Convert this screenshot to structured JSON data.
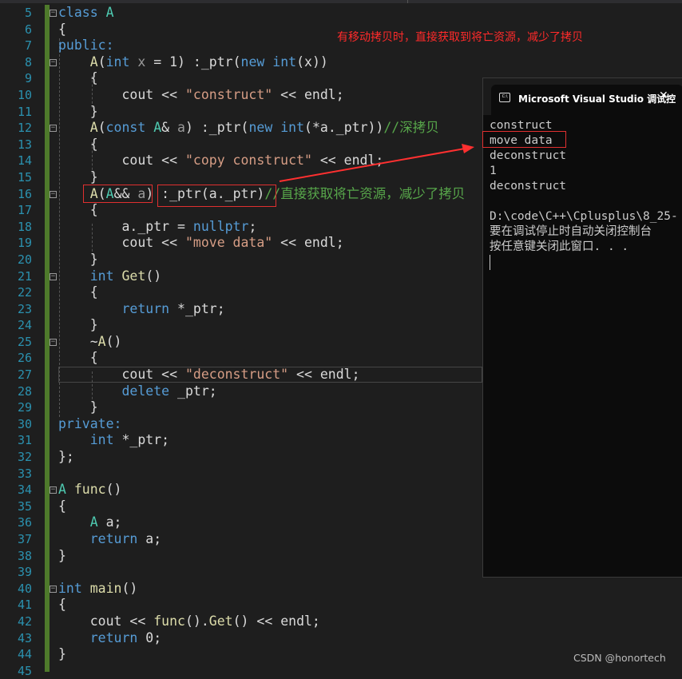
{
  "editor": {
    "line_numbers": [
      "5",
      "6",
      "7",
      "8",
      "9",
      "10",
      "11",
      "12",
      "13",
      "14",
      "15",
      "16",
      "17",
      "18",
      "19",
      "20",
      "21",
      "22",
      "23",
      "24",
      "25",
      "26",
      "27",
      "28",
      "29",
      "30",
      "31",
      "32",
      "33",
      "34",
      "35",
      "36",
      "37",
      "38",
      "39",
      "40",
      "41",
      "42",
      "43",
      "44",
      "45"
    ],
    "current_line": "27",
    "lines": [
      [
        [
          "class",
          "kw"
        ],
        [
          " ",
          ""
        ],
        [
          "A",
          "ty"
        ]
      ],
      [
        [
          "{",
          ""
        ]
      ],
      [
        [
          "public:",
          "kw"
        ]
      ],
      [
        [
          "    ",
          ""
        ],
        [
          "A",
          "fn"
        ],
        [
          "(",
          ""
        ],
        [
          "int",
          "kw"
        ],
        [
          " ",
          ""
        ],
        [
          "x",
          "pm"
        ],
        [
          " = 1) :_ptr(",
          ""
        ],
        [
          "new",
          "kw"
        ],
        [
          " ",
          ""
        ],
        [
          "int",
          "kw"
        ],
        [
          "(x))",
          ""
        ]
      ],
      [
        [
          "    {",
          ""
        ]
      ],
      [
        [
          "        cout << ",
          ""
        ],
        [
          "\"construct\"",
          "str"
        ],
        [
          " << endl;",
          ""
        ]
      ],
      [
        [
          "    }",
          ""
        ]
      ],
      [
        [
          "    ",
          ""
        ],
        [
          "A",
          "fn"
        ],
        [
          "(",
          ""
        ],
        [
          "const",
          "kw"
        ],
        [
          " ",
          ""
        ],
        [
          "A",
          "ty"
        ],
        [
          "& ",
          ""
        ],
        [
          "a",
          "pm"
        ],
        [
          ") :_ptr(",
          ""
        ],
        [
          "new",
          "kw"
        ],
        [
          " ",
          ""
        ],
        [
          "int",
          "kw"
        ],
        [
          "(*a._ptr))",
          ""
        ],
        [
          "//深拷贝",
          "cm"
        ]
      ],
      [
        [
          "    {",
          ""
        ]
      ],
      [
        [
          "        cout << ",
          ""
        ],
        [
          "\"copy construct\"",
          "str"
        ],
        [
          " << endl;",
          ""
        ]
      ],
      [
        [
          "    }",
          ""
        ]
      ],
      [
        [
          "    ",
          ""
        ],
        [
          "A",
          "fn"
        ],
        [
          "(",
          ""
        ],
        [
          "A",
          "ty"
        ],
        [
          "&& ",
          ""
        ],
        [
          "a",
          "pm"
        ],
        [
          ") :_ptr(a._ptr)",
          ""
        ],
        [
          "//直接获取将亡资源，减少了拷贝",
          "cm"
        ]
      ],
      [
        [
          "    {",
          ""
        ]
      ],
      [
        [
          "        a._ptr = ",
          ""
        ],
        [
          "nullptr",
          "kw"
        ],
        [
          ";",
          ""
        ]
      ],
      [
        [
          "        cout << ",
          ""
        ],
        [
          "\"move data\"",
          "str"
        ],
        [
          " << endl;",
          ""
        ]
      ],
      [
        [
          "    }",
          ""
        ]
      ],
      [
        [
          "    ",
          ""
        ],
        [
          "int",
          "kw"
        ],
        [
          " ",
          ""
        ],
        [
          "Get",
          "fn"
        ],
        [
          "()",
          ""
        ]
      ],
      [
        [
          "    {",
          ""
        ]
      ],
      [
        [
          "        ",
          ""
        ],
        [
          "return",
          "kw"
        ],
        [
          " *_ptr;",
          ""
        ]
      ],
      [
        [
          "    }",
          ""
        ]
      ],
      [
        [
          "    ~",
          ""
        ],
        [
          "A",
          "fn"
        ],
        [
          "()",
          ""
        ]
      ],
      [
        [
          "    {",
          ""
        ]
      ],
      [
        [
          "        cout << ",
          ""
        ],
        [
          "\"deconstruct\"",
          "str"
        ],
        [
          " << endl;",
          ""
        ]
      ],
      [
        [
          "        ",
          ""
        ],
        [
          "delete",
          "kw"
        ],
        [
          " _ptr;",
          ""
        ]
      ],
      [
        [
          "    }",
          ""
        ]
      ],
      [
        [
          "private:",
          "kw"
        ]
      ],
      [
        [
          "    ",
          ""
        ],
        [
          "int",
          "kw"
        ],
        [
          " *_ptr;",
          ""
        ]
      ],
      [
        [
          "};",
          ""
        ]
      ],
      [
        [
          "",
          ""
        ]
      ],
      [
        [
          "A",
          "ty"
        ],
        [
          " ",
          ""
        ],
        [
          "func",
          "fn"
        ],
        [
          "()",
          ""
        ]
      ],
      [
        [
          "{",
          ""
        ]
      ],
      [
        [
          "    ",
          ""
        ],
        [
          "A",
          "ty"
        ],
        [
          " a;",
          ""
        ]
      ],
      [
        [
          "    ",
          ""
        ],
        [
          "return",
          "kw"
        ],
        [
          " a;",
          ""
        ]
      ],
      [
        [
          "}",
          ""
        ]
      ],
      [
        [
          "",
          ""
        ]
      ],
      [
        [
          "int",
          "kw"
        ],
        [
          " ",
          ""
        ],
        [
          "main",
          "fn"
        ],
        [
          "()",
          ""
        ]
      ],
      [
        [
          "{",
          ""
        ]
      ],
      [
        [
          "    cout << ",
          ""
        ],
        [
          "func",
          "fn"
        ],
        [
          "().",
          ""
        ],
        [
          "Get",
          "fn"
        ],
        [
          "() << endl;",
          ""
        ]
      ],
      [
        [
          "    ",
          ""
        ],
        [
          "return",
          "kw"
        ],
        [
          " 0;",
          ""
        ]
      ],
      [
        [
          "}",
          ""
        ]
      ],
      [
        [
          "",
          ""
        ]
      ]
    ]
  },
  "annotation": "有移动拷贝时，直接获取到将亡资源，减少了拷贝",
  "console": {
    "title": "Microsoft Visual Studio 调试控",
    "icon": "console-icon",
    "output": [
      "construct",
      "move data",
      "deconstruct",
      "1",
      "deconstruct",
      "",
      "D:\\code\\C++\\Cplusplus\\8_25-",
      "要在调试停止时自动关闭控制台",
      "按任意键关闭此窗口. . ."
    ]
  },
  "watermark": "CSDN @honortech",
  "colors": {
    "highlight": "#e03030",
    "keyword": "#569cd6",
    "type": "#4ec9b0",
    "string": "#d69d85",
    "comment": "#57a64a"
  }
}
